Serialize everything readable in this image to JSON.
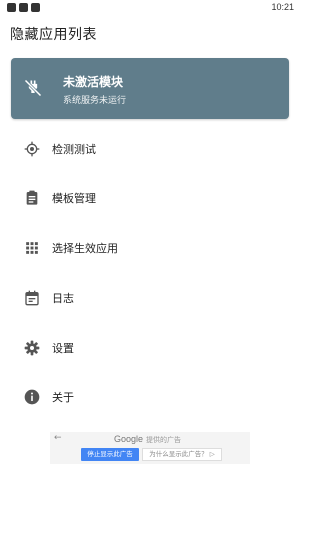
{
  "statusbar": {
    "time": "10:21"
  },
  "app": {
    "title": "隐藏应用列表"
  },
  "status_card": {
    "title": "未激活模块",
    "subtitle": "系统服务未运行",
    "icon": "module-off-icon",
    "color": "#607d8b"
  },
  "menu": [
    {
      "label": "检测测试",
      "icon": "target-icon"
    },
    {
      "label": "模板管理",
      "icon": "clipboard-icon"
    },
    {
      "label": "选择生效应用",
      "icon": "apps-grid-icon"
    },
    {
      "label": "日志",
      "icon": "calendar-icon"
    },
    {
      "label": "设置",
      "icon": "gear-icon"
    },
    {
      "label": "关于",
      "icon": "info-icon"
    }
  ],
  "ad": {
    "back": "←",
    "brand": "Google",
    "provided": "提供的广告",
    "stop_label": "停止显示此广告",
    "why_label": "为什么显示此广告？ ▷"
  }
}
